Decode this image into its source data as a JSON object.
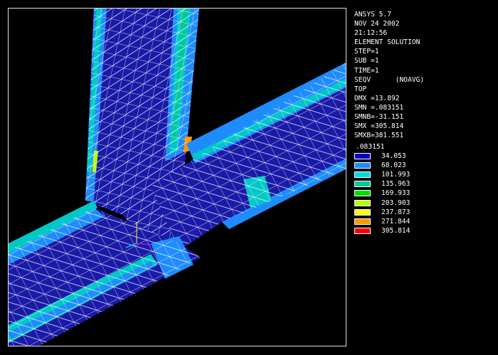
{
  "info": {
    "lines": [
      "ANSYS 5.7",
      "NOV 24 2002",
      "21:12:56",
      "ELEMENT SOLUTION",
      "STEP=1",
      "SUB =1",
      "TIME=1",
      "SEQV      (NOAVG)",
      "TOP",
      "DMX =13.892",
      "SMN =.083151",
      "SMNB=-31.151",
      "SMX =305.814",
      "SMXB=381.551"
    ]
  },
  "legend": {
    "first_value": ".083151",
    "bands": [
      {
        "value": "34.053",
        "color": "#0000c8"
      },
      {
        "value": "68.023",
        "color": "#1e8cff"
      },
      {
        "value": "101.993",
        "color": "#00dcdc"
      },
      {
        "value": "135.963",
        "color": "#00c896"
      },
      {
        "value": "169.933",
        "color": "#00dc00"
      },
      {
        "value": "203.903",
        "color": "#b4ff00"
      },
      {
        "value": "237.873",
        "color": "#ffff00"
      },
      {
        "value": "271.844",
        "color": "#ff9600"
      },
      {
        "value": "305.814",
        "color": "#ff0000"
      }
    ]
  },
  "colors": {
    "background": "#000000",
    "mesh_lines": "#ffffff",
    "low_stress": "#1a1aa8",
    "mid_stress": "#1e8cff",
    "edge_stress": "#00c8c8"
  }
}
